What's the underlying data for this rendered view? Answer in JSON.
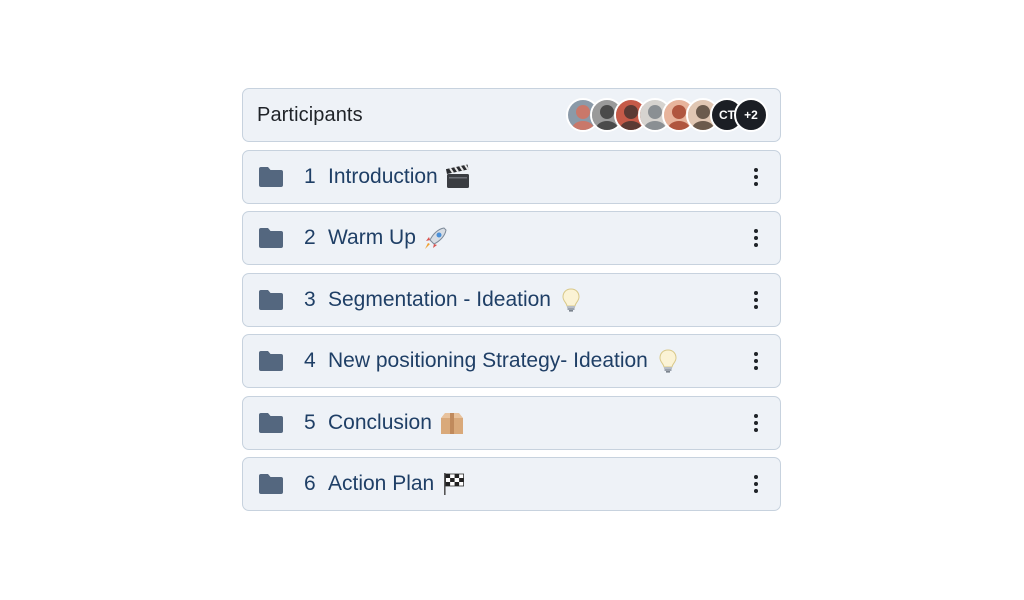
{
  "participants": {
    "title": "Participants",
    "avatars": [
      {
        "kind": "photo",
        "icon": "person-photo-icon",
        "colors": [
          "#c9786a",
          "#8b9aa8"
        ]
      },
      {
        "kind": "photo",
        "icon": "person-photo-icon",
        "colors": [
          "#4a4a4a",
          "#9a9a9a"
        ]
      },
      {
        "kind": "photo",
        "icon": "person-photo-icon",
        "colors": [
          "#5b3a34",
          "#c55a48"
        ]
      },
      {
        "kind": "photo",
        "icon": "person-photo-icon",
        "colors": [
          "#8a8f93",
          "#d6d3cf"
        ]
      },
      {
        "kind": "photo",
        "icon": "person-photo-icon",
        "colors": [
          "#b0563f",
          "#e8b49c"
        ]
      },
      {
        "kind": "photo",
        "icon": "person-photo-icon",
        "colors": [
          "#6b5a4c",
          "#e0c6b2"
        ]
      },
      {
        "kind": "initials",
        "text": "CT"
      },
      {
        "kind": "more",
        "text": "+2"
      }
    ]
  },
  "sections": [
    {
      "number": "1",
      "title": "Introduction",
      "emoji": "clapper-board-icon"
    },
    {
      "number": "2",
      "title": "Warm Up",
      "emoji": "rocket-icon"
    },
    {
      "number": "3",
      "title": "Segmentation - Ideation",
      "emoji": "light-bulb-icon"
    },
    {
      "number": "4",
      "title": "New positioning Strategy- Ideation",
      "emoji": "light-bulb-icon"
    },
    {
      "number": "5",
      "title": "Conclusion",
      "emoji": "package-box-icon"
    },
    {
      "number": "6",
      "title": "Action Plan",
      "emoji": "checkered-flag-icon"
    }
  ],
  "colors": {
    "card_bg": "#eef2f7",
    "card_border": "#c7d2de",
    "section_text": "#1f3f66",
    "folder_icon": "#54677f"
  }
}
